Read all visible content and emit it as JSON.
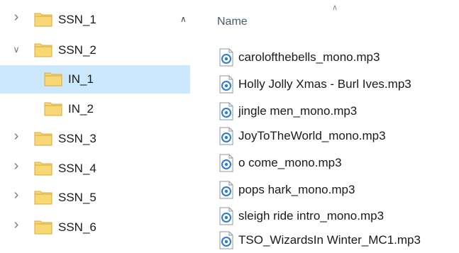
{
  "navigation": {
    "items": [
      {
        "label": "SSN_1",
        "expanded": false,
        "has_chevron": true,
        "level": 0,
        "selected": false
      },
      {
        "label": "SSN_2",
        "expanded": true,
        "has_chevron": true,
        "level": 0,
        "selected": false
      },
      {
        "label": "IN_1",
        "expanded": false,
        "has_chevron": false,
        "level": 1,
        "selected": true
      },
      {
        "label": "IN_2",
        "expanded": false,
        "has_chevron": false,
        "level": 1,
        "selected": false
      },
      {
        "label": "SSN_3",
        "expanded": false,
        "has_chevron": true,
        "level": 0,
        "selected": false
      },
      {
        "label": "SSN_4",
        "expanded": false,
        "has_chevron": true,
        "level": 0,
        "selected": false
      },
      {
        "label": "SSN_5",
        "expanded": false,
        "has_chevron": true,
        "level": 0,
        "selected": false
      },
      {
        "label": "SSN_6",
        "expanded": false,
        "has_chevron": true,
        "level": 0,
        "selected": false
      }
    ],
    "icons": {
      "collapsed": "chevron-right-icon",
      "expanded": "chevron-down-icon",
      "folder": "folder-icon"
    },
    "selection_color": "#cce8ff",
    "folder_color": "#f8d775"
  },
  "file_list": {
    "column_header": "Name",
    "sort": "ascending",
    "files": [
      {
        "name": "carolofthebells_mono.mp3",
        "icon": "audio-file-icon"
      },
      {
        "name": "Holly Jolly Xmas - Burl Ives.mp3",
        "icon": "audio-file-icon"
      },
      {
        "name": "jingle men_mono.mp3",
        "icon": "audio-file-icon"
      },
      {
        "name": "JoyToTheWorld_mono.mp3",
        "icon": "audio-file-icon"
      },
      {
        "name": "o come_mono.mp3",
        "icon": "audio-file-icon"
      },
      {
        "name": "pops hark_mono.mp3",
        "icon": "audio-file-icon"
      },
      {
        "name": "sleigh ride intro_mono.mp3",
        "icon": "audio-file-icon"
      },
      {
        "name": "TSO_WizardsIn Winter_MC1.mp3",
        "icon": "audio-file-icon"
      }
    ],
    "accent_color": "#2b79d8"
  }
}
